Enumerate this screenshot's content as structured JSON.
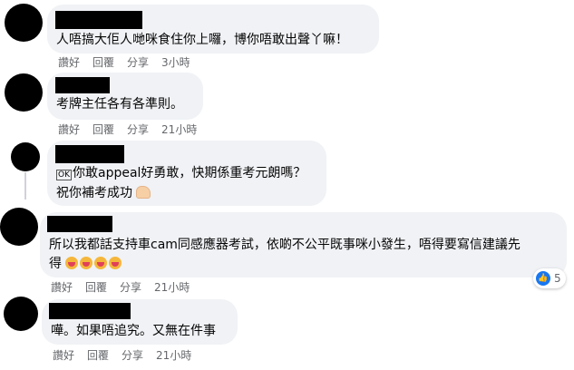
{
  "comments": [
    {
      "text_lines": [
        "人唔搞大佢人哋咪食住你上囉，博你唔敢出聲丫嘛！"
      ],
      "actions": {
        "like": "讚好",
        "reply": "回覆",
        "share": "分享",
        "time": "3小時"
      }
    },
    {
      "text_lines": [
        "考牌主任各有各準則。"
      ],
      "actions": {
        "like": "讚好",
        "reply": "回覆",
        "share": "分享",
        "time": "21小時"
      }
    },
    {
      "text_prefix_box": "OK",
      "text_lines": [
        "你敢appeal好勇敢，快期係重考元朗嗎？",
        "祝你補考成功"
      ],
      "emoji": "flexed-biceps",
      "actions": {
        "like": "讚好",
        "reply": "回覆",
        "share": "分享",
        "time": "21小時"
      }
    },
    {
      "text_lines": [
        "所以我都話支持車cam同感應器考試，依啲不公平既事咪小發生，唔得要寫信建議先",
        "得"
      ],
      "emojis": [
        "crying-face",
        "crying-face",
        "crying-face",
        "crying-face"
      ],
      "reaction": {
        "icon": "like-icon",
        "count": "5"
      },
      "actions": {
        "like": "讚好",
        "reply": "回覆",
        "share": "分享",
        "time": "21小時"
      }
    },
    {
      "text_lines": [
        "嘩。如果唔追究。又無在件事"
      ],
      "actions": {
        "like": "讚好",
        "reply": "回覆",
        "share": "分享",
        "time": "21小時"
      }
    }
  ],
  "colors": {
    "bubble": "#f0f2f5",
    "meta_text": "#65676b",
    "like_blue": "#1877f2"
  }
}
